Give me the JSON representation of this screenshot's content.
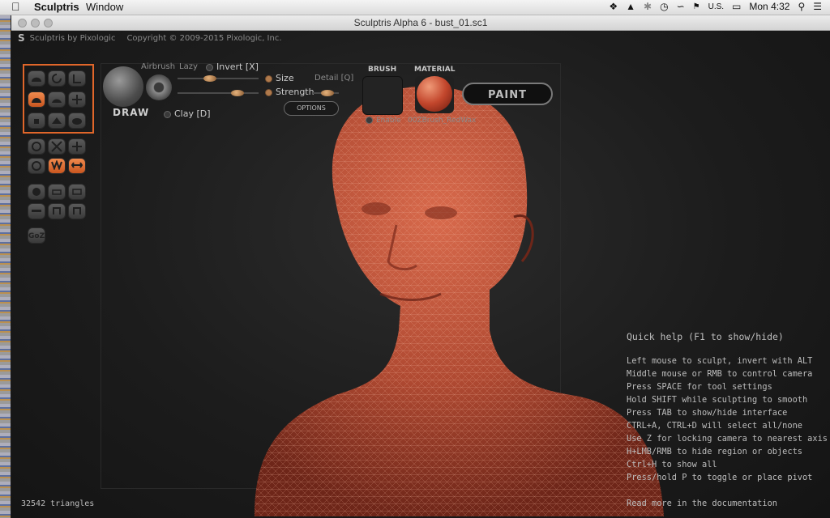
{
  "menubar": {
    "apple": "",
    "app_name": "Sculptris",
    "window_menu": "Window",
    "tray": {
      "input": "U.S.",
      "clock": "Mon 4:32"
    }
  },
  "window": {
    "title": "Sculptris Alpha 6 - bust_01.sc1"
  },
  "app": {
    "logo": "S",
    "brand": "Sculptris by Pixologic",
    "copyright": "Copyright © 2009-2015 Pixologic, Inc."
  },
  "toolbar": {
    "draw_label": "DRAW",
    "airbrush": "Airbrush",
    "lazy": "Lazy",
    "invert": "Invert [X]",
    "size": "Size",
    "strength": "Strength",
    "detail": "Detail [Q]",
    "clay": "Clay [D]",
    "options": "OPTIONS",
    "brush_title": "BRUSH",
    "enable": "Enable",
    "material_title": "MATERIAL",
    "material_name": "00ZBrush_RedWax",
    "paint": "PAINT",
    "goz": "GoZ"
  },
  "quick_help": {
    "title": "Quick help (F1 to show/hide)",
    "lines": [
      "Left mouse to sculpt, invert with ALT",
      "Middle mouse or RMB to control camera",
      "Press SPACE for tool settings",
      "Hold SHIFT while sculpting to smooth",
      "Press TAB to show/hide interface",
      "CTRL+A, CTRL+D will select all/none",
      "Use Z for locking camera to nearest axis",
      "H+LMB/RMB to hide region or objects",
      "Ctrl+H to show all",
      "Press/hold P to toggle or place pivot"
    ],
    "doc": "Read more in the documentation"
  },
  "status": {
    "triangles": "32542 triangles"
  },
  "colors": {
    "accent": "#e0662a",
    "wax": "#c2462c"
  }
}
